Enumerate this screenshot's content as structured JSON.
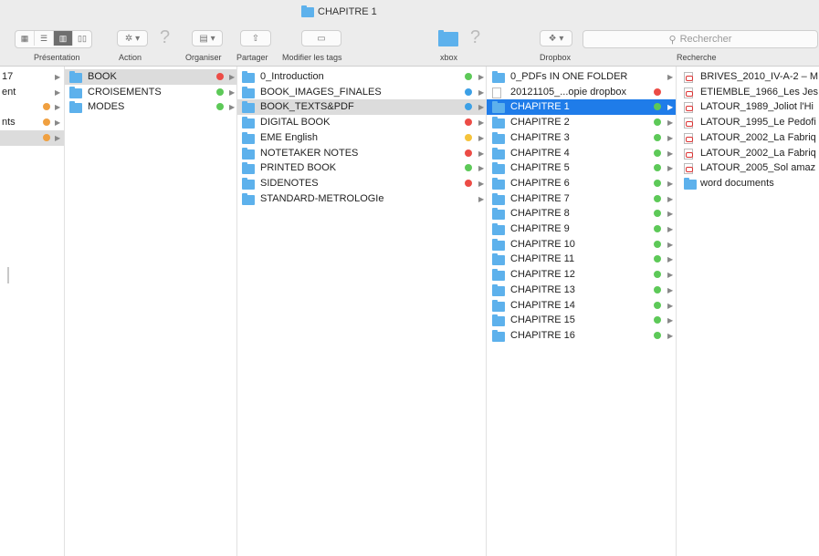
{
  "window": {
    "title": "CHAPITRE 1"
  },
  "toolbar": {
    "presentation_label": "Présentation",
    "action_label": "Action",
    "organiser_label": "Organiser",
    "partager_label": "Partager",
    "tags_label": "Modifier les tags",
    "xbox_label": "xbox",
    "dropbox_label": "Dropbox",
    "recherche_label": "Recherche",
    "search_placeholder": "Rechercher"
  },
  "columns": {
    "col0": [
      {
        "label": "17",
        "dot": null
      },
      {
        "label": "ent",
        "dot": null
      },
      {
        "label": "",
        "dot": "#f0a040"
      },
      {
        "label": "nts",
        "dot": "#f0a040"
      },
      {
        "label": "",
        "dot": "#f0a040"
      }
    ],
    "col1": [
      {
        "label": "BOOK",
        "dot": "#ec4c46"
      },
      {
        "label": "CROISEMENTS",
        "dot": "#5dc958"
      },
      {
        "label": "MODES",
        "dot": "#5dc958"
      }
    ],
    "col2": [
      {
        "label": "0_Introduction",
        "dot": "#5dc958"
      },
      {
        "label": "BOOK_IMAGES_FINALES",
        "dot": "#3ca0e6"
      },
      {
        "label": "BOOK_TEXTS&PDF",
        "dot": "#3ca0e6"
      },
      {
        "label": "DIGITAL BOOK",
        "dot": "#ec4c46"
      },
      {
        "label": "EME English",
        "dot": "#f5c33b"
      },
      {
        "label": "NOTETAKER NOTES",
        "dot": "#ec4c46"
      },
      {
        "label": "PRINTED BOOK",
        "dot": "#5dc958"
      },
      {
        "label": "SIDENOTES",
        "dot": "#ec4c46"
      },
      {
        "label": "STANDARD-METROLOGIe",
        "dot": null
      }
    ],
    "col3": [
      {
        "label": "0_PDFs IN ONE FOLDER",
        "dot": null,
        "kind": "folder"
      },
      {
        "label": "20121105_...opie dropbox",
        "dot": "#ec4c46",
        "kind": "doc"
      },
      {
        "label": "CHAPITRE 1",
        "dot": "#5dc958",
        "kind": "folder"
      },
      {
        "label": "CHAPITRE 2",
        "dot": "#5dc958",
        "kind": "folder"
      },
      {
        "label": "CHAPITRE 3",
        "dot": "#5dc958",
        "kind": "folder"
      },
      {
        "label": "CHAPITRE 4",
        "dot": "#5dc958",
        "kind": "folder"
      },
      {
        "label": "CHAPITRE 5",
        "dot": "#5dc958",
        "kind": "folder"
      },
      {
        "label": "CHAPITRE 6",
        "dot": "#5dc958",
        "kind": "folder"
      },
      {
        "label": "CHAPITRE 7",
        "dot": "#5dc958",
        "kind": "folder"
      },
      {
        "label": "CHAPITRE 8",
        "dot": "#5dc958",
        "kind": "folder"
      },
      {
        "label": "CHAPITRE 9",
        "dot": "#5dc958",
        "kind": "folder"
      },
      {
        "label": "CHAPITRE 10",
        "dot": "#5dc958",
        "kind": "folder"
      },
      {
        "label": "CHAPITRE 11",
        "dot": "#5dc958",
        "kind": "folder"
      },
      {
        "label": "CHAPITRE 12",
        "dot": "#5dc958",
        "kind": "folder"
      },
      {
        "label": "CHAPITRE 13",
        "dot": "#5dc958",
        "kind": "folder"
      },
      {
        "label": "CHAPITRE 14",
        "dot": "#5dc958",
        "kind": "folder"
      },
      {
        "label": "CHAPITRE 15",
        "dot": "#5dc958",
        "kind": "folder"
      },
      {
        "label": "CHAPITRE 16",
        "dot": "#5dc958",
        "kind": "folder"
      }
    ],
    "col4": [
      {
        "label": "BRIVES_2010_IV-A-2 – M",
        "kind": "pdf"
      },
      {
        "label": "ETIEMBLE_1966_Les Jes",
        "kind": "pdf"
      },
      {
        "label": "LATOUR_1989_Joliot l'Hi",
        "kind": "pdf"
      },
      {
        "label": "LATOUR_1995_Le Pedofi",
        "kind": "pdf"
      },
      {
        "label": "LATOUR_2002_La Fabriq",
        "kind": "pdf"
      },
      {
        "label": "LATOUR_2002_La Fabriq",
        "kind": "pdf"
      },
      {
        "label": "LATOUR_2005_Sol amaz",
        "kind": "pdf"
      },
      {
        "label": "word documents",
        "kind": "folder"
      }
    ]
  },
  "selection": {
    "col0": 4,
    "col1": 0,
    "col2": 2,
    "col3": 2
  }
}
